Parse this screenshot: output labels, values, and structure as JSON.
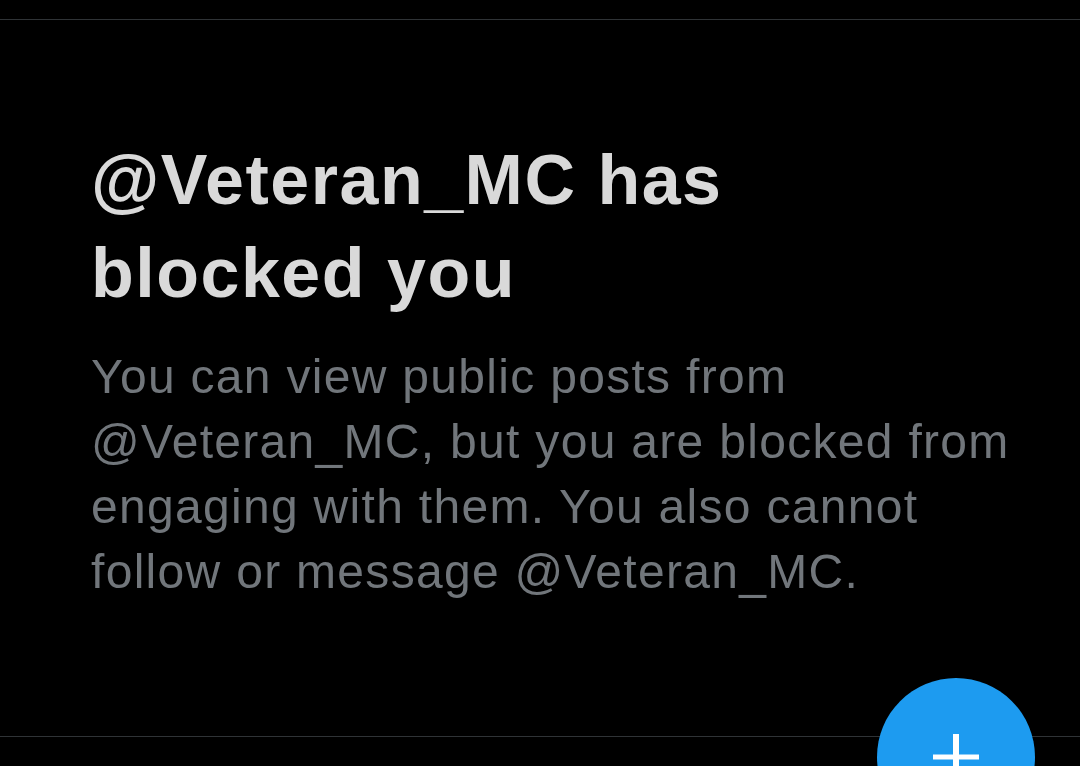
{
  "blocked_notice": {
    "title": "@Veteran_MC has blocked you",
    "message": "You can view public posts from @Veteran_MC, but you are blocked from engaging with them. You also cannot follow or message @Veteran_MC."
  }
}
